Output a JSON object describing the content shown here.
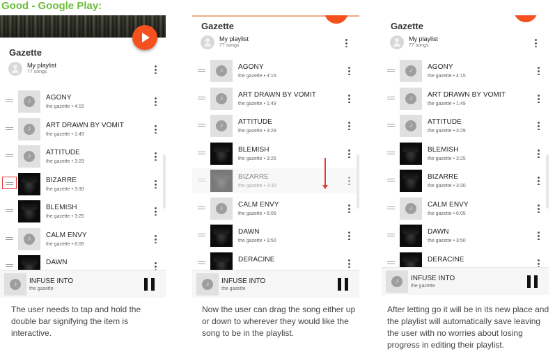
{
  "heading": "Good - Google Play:",
  "playlist": {
    "title": "Gazette",
    "owner": "My playlist",
    "count": "77 songs"
  },
  "now_playing": {
    "title": "INFUSE INTO",
    "artist": "the gazette"
  },
  "panels": [
    {
      "tracks": [
        {
          "name": "AGONY",
          "meta": "the gazette • 4:15",
          "art": "note"
        },
        {
          "name": "ART DRAWN BY VOMIT",
          "meta": "the gazette • 1:49",
          "art": "note"
        },
        {
          "name": "ATTITUDE",
          "meta": "the gazette • 3:29",
          "art": "note"
        },
        {
          "name": "BIZARRE",
          "meta": "the gazette • 3:30",
          "art": "photo",
          "highlight_grip": true
        },
        {
          "name": "BLEMISH",
          "meta": "the gazette • 3:25",
          "art": "photo"
        },
        {
          "name": "CALM ENVY",
          "meta": "the gazette • 6:05",
          "art": "note"
        },
        {
          "name": "DAWN",
          "meta": "",
          "art": "photo"
        }
      ]
    },
    {
      "tracks": [
        {
          "name": "AGONY",
          "meta": "the gazette • 4:15",
          "art": "note"
        },
        {
          "name": "ART DRAWN BY VOMIT",
          "meta": "the gazette • 1:49",
          "art": "note"
        },
        {
          "name": "ATTITUDE",
          "meta": "the gazette • 3:29",
          "art": "note"
        },
        {
          "name": "BLEMISH",
          "meta": "the gazette • 3:25",
          "art": "photo"
        },
        {
          "name": "BIZARRE",
          "meta": "the gazette • 3:30",
          "art": "photo",
          "dragging": true
        },
        {
          "name": "CALM ENVY",
          "meta": "the gazette • 6:05",
          "art": "note"
        },
        {
          "name": "DAWN",
          "meta": "the gazette • 3:50",
          "art": "photo"
        },
        {
          "name": "DERACINE",
          "meta": "",
          "art": "photo"
        }
      ]
    },
    {
      "tracks": [
        {
          "name": "AGONY",
          "meta": "the gazette • 4:15",
          "art": "note"
        },
        {
          "name": "ART DRAWN BY VOMIT",
          "meta": "the gazette • 1:49",
          "art": "note"
        },
        {
          "name": "ATTITUDE",
          "meta": "the gazette • 3:29",
          "art": "note"
        },
        {
          "name": "BLEMISH",
          "meta": "the gazette • 3:25",
          "art": "photo"
        },
        {
          "name": "BIZARRE",
          "meta": "the gazette • 3:30",
          "art": "photo"
        },
        {
          "name": "CALM ENVY",
          "meta": "the gazette • 6:05",
          "art": "note"
        },
        {
          "name": "DAWN",
          "meta": "the gazette • 3:50",
          "art": "photo"
        },
        {
          "name": "DERACINE",
          "meta": "",
          "art": "photo"
        }
      ]
    }
  ],
  "captions": [
    "The user needs to tap and hold the double bar signifying the item is interactive.",
    "Now the user can drag the song either up or down to wherever they would like the song to be in the playlist.",
    "After letting go it will be in its new place and the playlist will automatically save leaving the user with no worries about losing progress in editing their playlist."
  ],
  "colors": {
    "accent": "#f4511e",
    "heading": "#6bbf3a",
    "highlight": "#e53935"
  },
  "icons": [
    "play-icon",
    "pause-icon",
    "drag-handle-icon",
    "more-vert-icon",
    "music-note-icon",
    "avatar-icon"
  ]
}
